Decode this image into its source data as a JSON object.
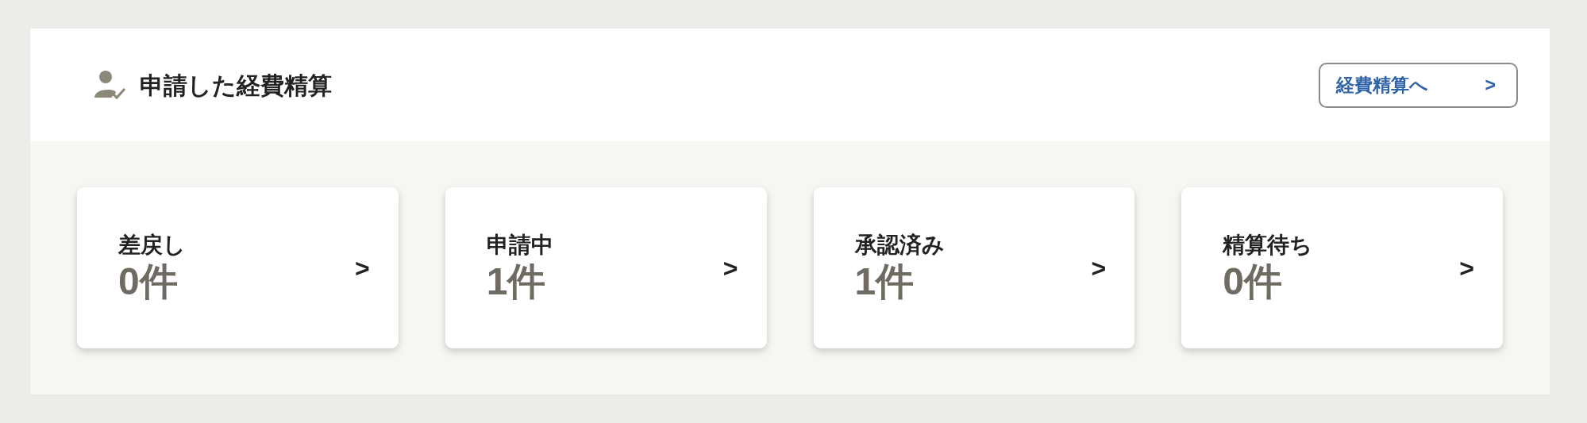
{
  "panel": {
    "title": "申請した経費精算",
    "link": {
      "label": "経費精算へ",
      "arrow": ">"
    }
  },
  "status_cards": [
    {
      "label": "差戻し",
      "count": "0件",
      "arrow": ">"
    },
    {
      "label": "申請中",
      "count": "1件",
      "arrow": ">"
    },
    {
      "label": "承認済み",
      "count": "1件",
      "arrow": ">"
    },
    {
      "label": "精算待ち",
      "count": "0件",
      "arrow": ">"
    }
  ]
}
